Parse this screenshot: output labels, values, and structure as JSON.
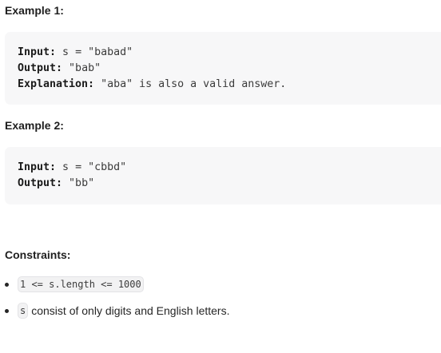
{
  "example1": {
    "heading": "Example 1:",
    "lines": [
      {
        "key": "Input:",
        "value": " s = \"babad\""
      },
      {
        "key": "Output:",
        "value": " \"bab\""
      },
      {
        "key": "Explanation:",
        "value": " \"aba\" is also a valid answer."
      }
    ]
  },
  "example2": {
    "heading": "Example 2:",
    "lines": [
      {
        "key": "Input:",
        "value": " s = \"cbbd\""
      },
      {
        "key": "Output:",
        "value": " \"bb\""
      }
    ]
  },
  "constraints": {
    "heading": "Constraints:",
    "items": [
      {
        "code": "1 <= s.length <= 1000",
        "text": ""
      },
      {
        "code": "s",
        "text": "consist of only digits and English letters."
      }
    ]
  }
}
